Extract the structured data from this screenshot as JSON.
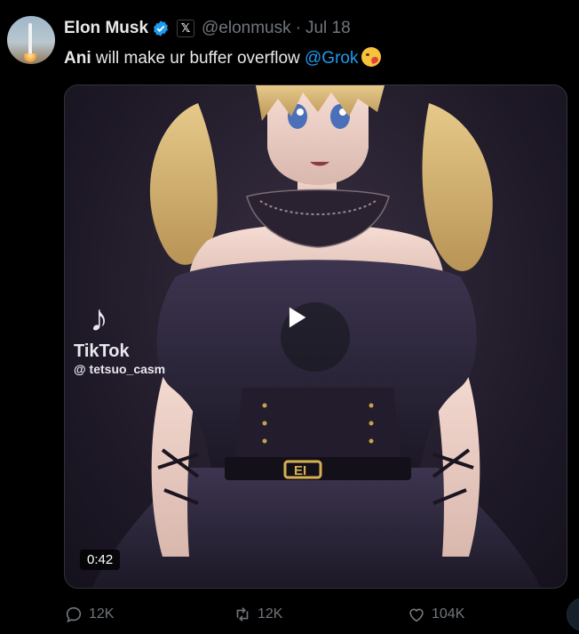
{
  "tweet": {
    "author_name": "Elon Musk",
    "handle": "@elonmusk",
    "separator": "·",
    "date": "Jul 18",
    "text_bold": "Ani",
    "text_plain": " will make ur buffer overflow ",
    "mention": "@Grok",
    "emoji": "kissing-face-emoji"
  },
  "media": {
    "watermark_logo": "♪",
    "watermark_app": "TikTok",
    "watermark_user": "@ tetsuo_casm",
    "duration": "0:42",
    "belt_buckle_text": "EI"
  },
  "actions": {
    "replies": "12K",
    "reposts": "12K",
    "likes": "104K"
  },
  "colors": {
    "background": "#000000",
    "text": "#e7e9ea",
    "muted": "#71767b",
    "accent": "#1d9bf0"
  }
}
